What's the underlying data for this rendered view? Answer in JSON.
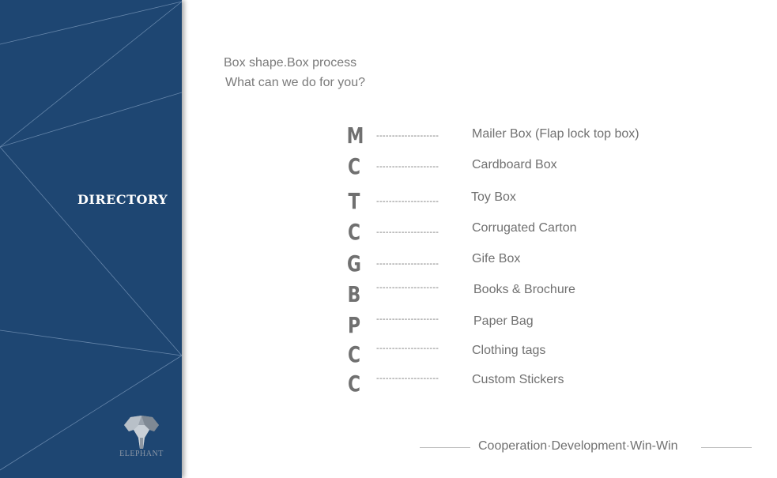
{
  "sidebar": {
    "title": "DIRECTORY",
    "logo_text": "ELEPHANT"
  },
  "intro": {
    "line1": "Box shape.Box process",
    "line2": "What can we do for you?"
  },
  "directory": {
    "separator": "--------------------",
    "items": [
      {
        "letter": "M",
        "label": "Mailer Box (Flap lock top box)"
      },
      {
        "letter": "C",
        "label": "Cardboard Box"
      },
      {
        "letter": "T",
        "label": "Toy Box"
      },
      {
        "letter": "C",
        "label": "Corrugated Carton"
      },
      {
        "letter": "G",
        "label": "Gife Box"
      },
      {
        "letter": "B",
        "label": "Books & Brochure"
      },
      {
        "letter": "P",
        "label": "Paper Bag"
      },
      {
        "letter": "C",
        "label": "Clothing tags"
      },
      {
        "letter": "C",
        "label": "Custom Stickers"
      }
    ]
  },
  "footer": {
    "motto": "Cooperation·Development·Win-Win"
  },
  "colors": {
    "sidebar_bg": "#1e4672",
    "text_gray": "#707070"
  }
}
